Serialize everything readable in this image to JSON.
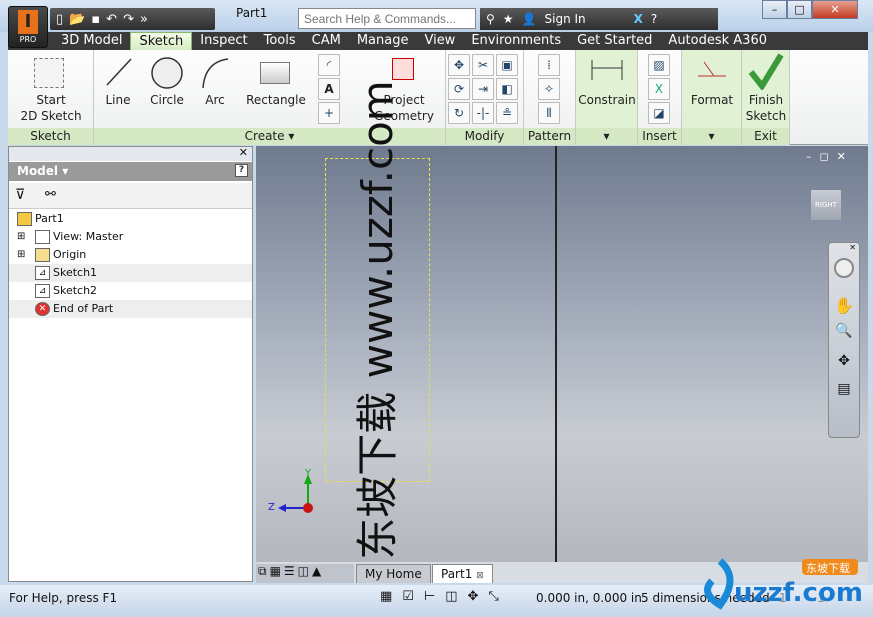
{
  "app": {
    "badge": "PRO",
    "document_title": "Part1"
  },
  "search": {
    "placeholder": "Search Help & Commands..."
  },
  "account": {
    "sign_in": "Sign In"
  },
  "tabs": [
    {
      "label": "3D Model"
    },
    {
      "label": "Sketch",
      "active": true
    },
    {
      "label": "Inspect"
    },
    {
      "label": "Tools"
    },
    {
      "label": "CAM"
    },
    {
      "label": "Manage"
    },
    {
      "label": "View"
    },
    {
      "label": "Environments"
    },
    {
      "label": "Get Started"
    },
    {
      "label": "Autodesk A360"
    }
  ],
  "ribbon": {
    "sketch": {
      "label": "Sketch",
      "start": "Start",
      "start2": "2D Sketch"
    },
    "create": {
      "label": "Create ▾",
      "line": "Line",
      "circle": "Circle",
      "arc": "Arc",
      "rectangle": "Rectangle",
      "project": "Project",
      "project2": "Geometry"
    },
    "modify": {
      "label": "Modify"
    },
    "pattern": {
      "label": "Pattern"
    },
    "constrain": {
      "label": "Constrain"
    },
    "insert": {
      "label": "Insert"
    },
    "format": {
      "label": "Format"
    },
    "exit": {
      "label": "Exit",
      "finish": "Finish",
      "finish2": "Sketch"
    }
  },
  "browser": {
    "title": "Model ▾",
    "items": [
      {
        "label": "Part1"
      },
      {
        "label": "View: Master"
      },
      {
        "label": "Origin"
      },
      {
        "label": "Sketch1"
      },
      {
        "label": "Sketch2"
      },
      {
        "label": "End of Part"
      }
    ]
  },
  "viewport": {
    "sketch_text": "东坡下载 www.uzzf.com",
    "viewcube": "RIGHT",
    "axis_y": "Y",
    "axis_z": "Z"
  },
  "doc_tabs": [
    {
      "label": "My Home"
    },
    {
      "label": "Part1"
    }
  ],
  "status": {
    "help": "For Help, press F1",
    "coords": "0.000 in, 0.000 in",
    "dims": "5 dimensions needed",
    "v1": "1",
    "v2": "1"
  },
  "watermark": {
    "text": "uzzf.com",
    "sub": "东坡下载"
  },
  "colors": {
    "accent_green": "#d4e8c4",
    "tab_bar": "#3a3a3a",
    "app_orange": "#e8721c"
  }
}
